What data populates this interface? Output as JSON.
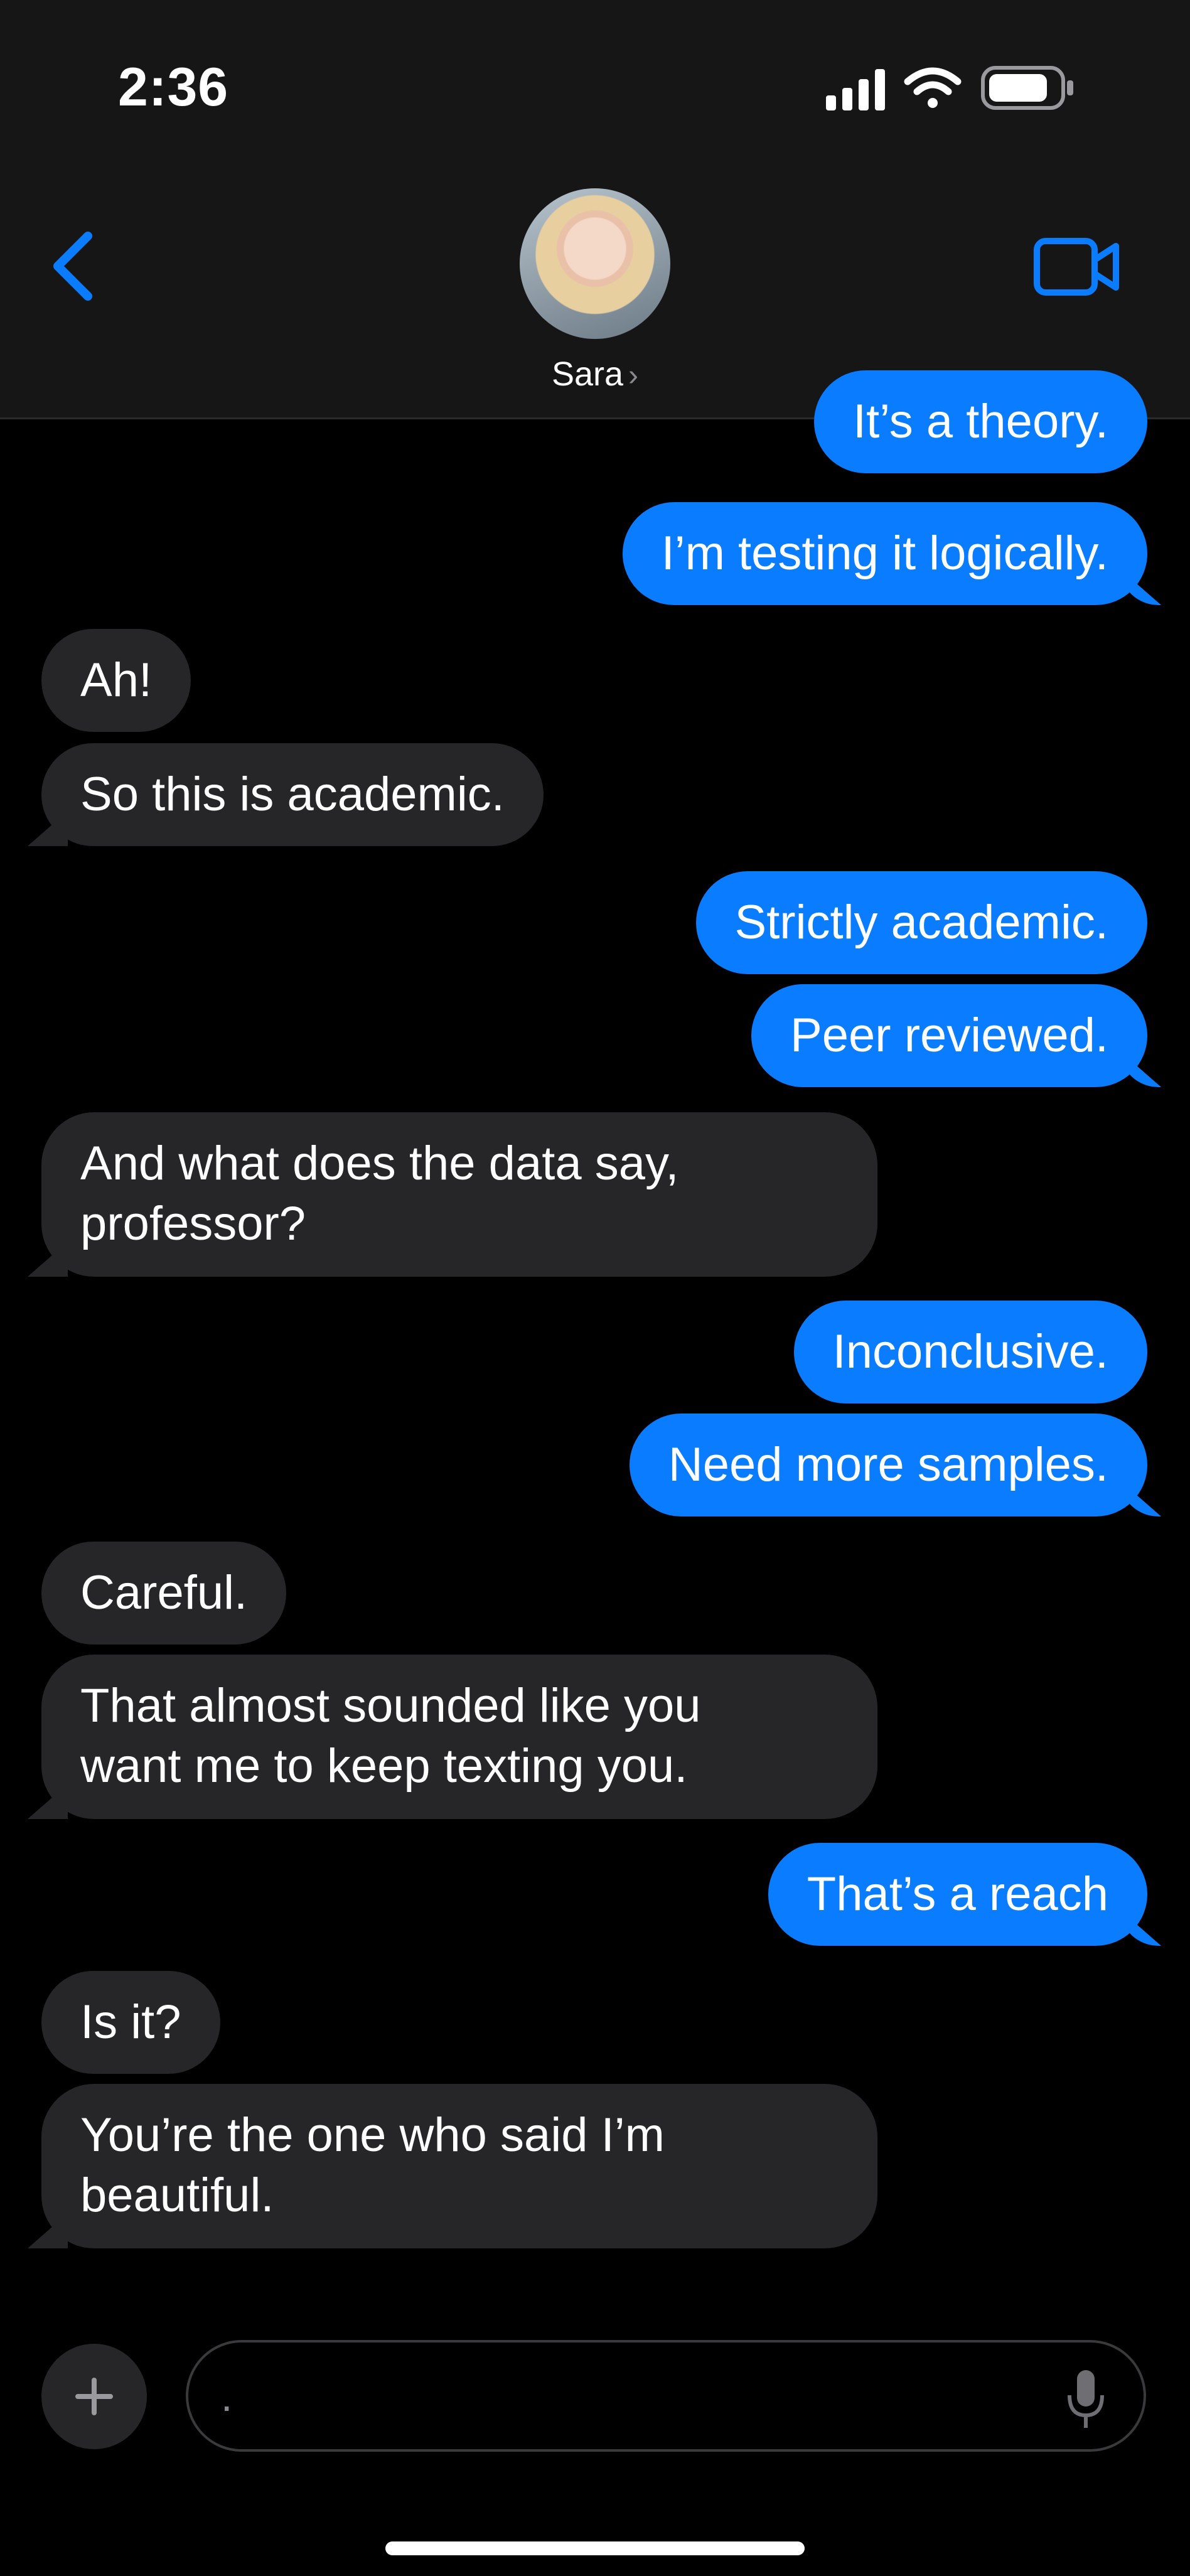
{
  "status_bar": {
    "time": "2:36"
  },
  "header": {
    "contact_name": "Sara",
    "name_chevron": "›"
  },
  "messages": [
    {
      "text": "It’s a theory."
    },
    {
      "text": "I’m testing it logically."
    },
    {
      "text": "Ah!"
    },
    {
      "text": "So this is academic."
    },
    {
      "text": "Strictly academic."
    },
    {
      "text": "Peer reviewed."
    },
    {
      "text": "And what does the data say,\nprofessor?"
    },
    {
      "text": "Inconclusive."
    },
    {
      "text": "Need more samples."
    },
    {
      "text": "Careful."
    },
    {
      "text": "That almost sounded like you\nwant me to keep texting you."
    },
    {
      "text": "That’s a reach"
    },
    {
      "text": "Is it?"
    },
    {
      "text": "You’re the one who said I’m\nbeautiful."
    }
  ],
  "composer": {
    "placeholder": "."
  },
  "colors": {
    "outgoing_bubble": "#0a7cff",
    "incoming_bubble": "#262629",
    "accent": "#0a7cff",
    "header_bg": "#161616"
  },
  "icons": [
    "back-chevron-icon",
    "video-call-icon",
    "plus-icon",
    "microphone-icon",
    "cellular-signal-icon",
    "wifi-icon",
    "battery-icon"
  ]
}
